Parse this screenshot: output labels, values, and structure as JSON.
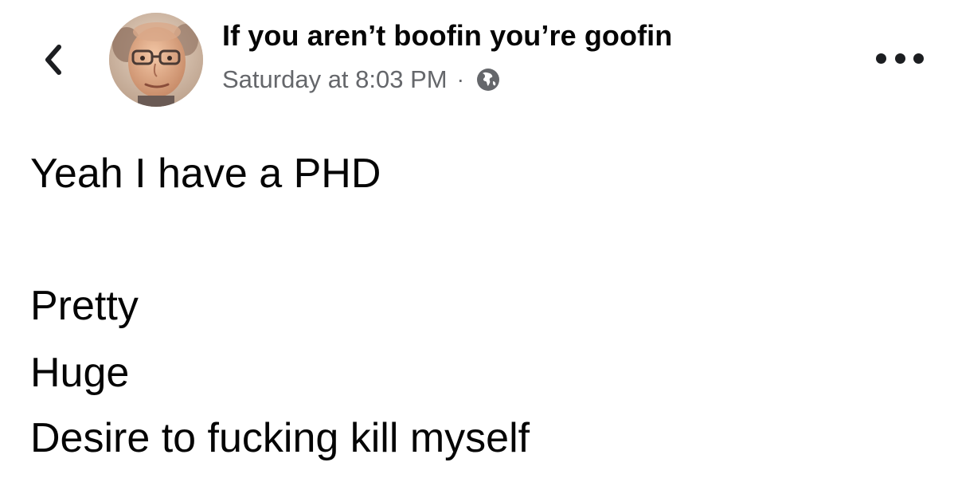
{
  "header": {
    "back_icon": "chevron-left-icon",
    "author_name": "If you aren’t boofin you’re goofin",
    "timestamp": "Saturday at 8:03 PM",
    "separator": "·",
    "privacy_icon": "globe-icon",
    "more_icon": "more-horizontal-icon"
  },
  "post": {
    "lines": [
      "Yeah I have a PHD",
      "Pretty",
      "Huge",
      "Desire to fucking kill myself"
    ]
  },
  "colors": {
    "text_primary": "#050505",
    "text_secondary": "#65676b",
    "background": "#ffffff"
  }
}
